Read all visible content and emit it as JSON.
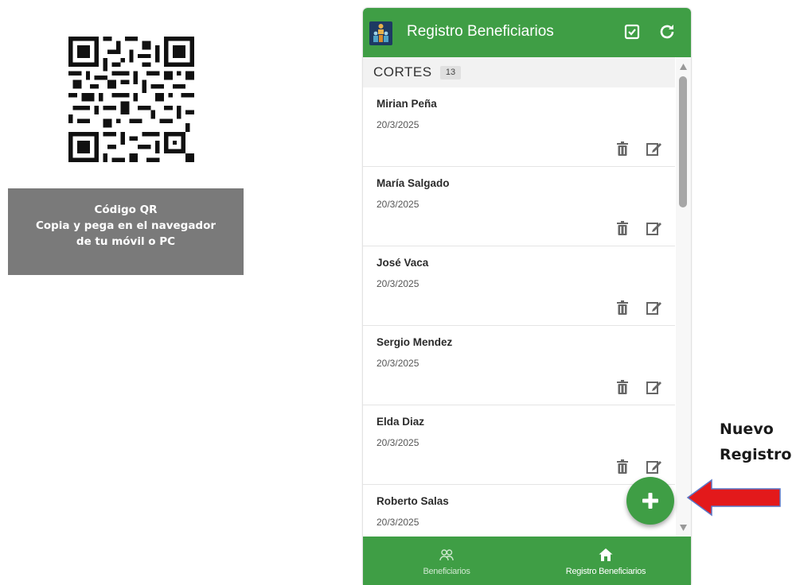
{
  "qr": {
    "caption_line1": "Código QR",
    "caption_line2": "Copia y pega en el navegador",
    "caption_line3": "de tu móvil o PC"
  },
  "app": {
    "title": "Registro Beneficiarios",
    "header_icons": [
      "checkbox-icon",
      "refresh-icon"
    ],
    "accent_color": "#3f9e45"
  },
  "section": {
    "title": "CORTES",
    "count": "13"
  },
  "records": [
    {
      "name": "Mirian Peña",
      "date": "20/3/2025"
    },
    {
      "name": "María Salgado",
      "date": "20/3/2025"
    },
    {
      "name": "José Vaca",
      "date": "20/3/2025"
    },
    {
      "name": "Sergio Mendez",
      "date": "20/3/2025"
    },
    {
      "name": "Elda Diaz",
      "date": "20/3/2025"
    },
    {
      "name": "Roberto Salas",
      "date": "20/3/2025"
    }
  ],
  "bottom_nav": {
    "items": [
      {
        "label": "Beneficiarios",
        "icon": "people-icon"
      },
      {
        "label": "Registro Beneficiarios",
        "icon": "home-icon",
        "active": true
      }
    ]
  },
  "annotation": {
    "line1": "Nuevo",
    "line2": "Registro",
    "arrow_color": "#e3191b"
  }
}
